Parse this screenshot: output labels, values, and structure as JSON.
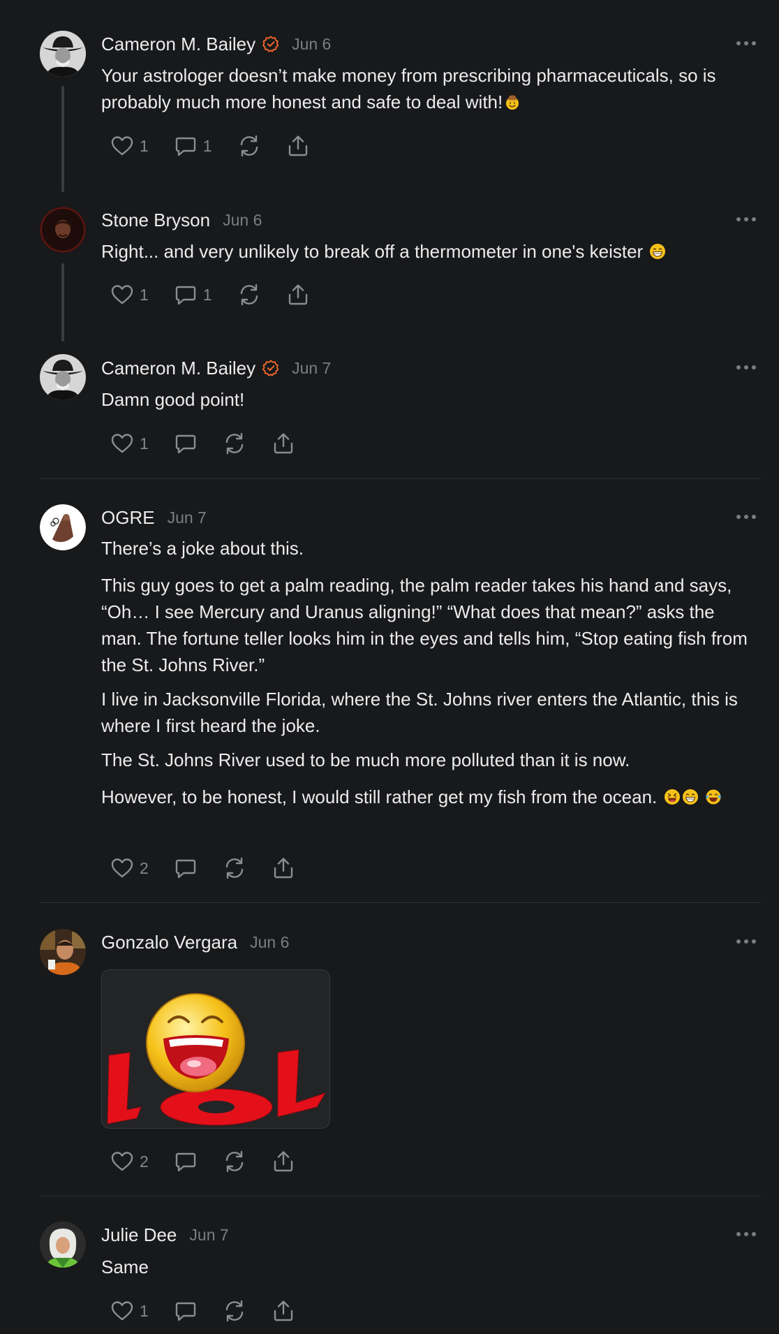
{
  "comments": [
    {
      "author": "Cameron M. Bailey",
      "verified": true,
      "date": "Jun 6",
      "paragraphs": [
        "Your astrologer doesn’t make money from prescribing pharmaceuticals, so is probably much more honest and safe to deal with!"
      ],
      "emoji": "cowboy-face",
      "likes": "1",
      "replies": "1"
    },
    {
      "author": "Stone Bryson",
      "verified": false,
      "date": "Jun 6",
      "paragraphs": [
        "Right... and very unlikely to break off a thermometer in one's keister"
      ],
      "emoji": "grinning-face",
      "likes": "1",
      "replies": "1"
    },
    {
      "author": "Cameron M. Bailey",
      "verified": true,
      "date": "Jun 7",
      "paragraphs": [
        "Damn good point!"
      ],
      "likes": "1",
      "replies": ""
    },
    {
      "author": "OGRE",
      "verified": false,
      "date": "Jun 7",
      "paragraphs": [
        "There’s a joke about this.",
        "This guy goes to get a palm reading, the palm reader takes his hand and says, “Oh… I see Mercury and Uranus aligning!” “What does that mean?” asks the man. The fortune teller looks him in the eyes and tells him, “Stop eating fish from the St. Johns River.”",
        "I live in Jacksonville Florida, where the St. Johns river enters the Atlantic, this is where I first heard the joke.",
        "The St. Johns River used to be much more polluted than it is now.",
        "However, to be honest, I would still rather get my fish from the ocean."
      ],
      "emoji_trailing": [
        "laughing-squint-face",
        "grinning-face",
        "tears-of-joy-face"
      ],
      "likes": "2",
      "replies": ""
    },
    {
      "author": "Gonzalo Vergara",
      "verified": false,
      "date": "Jun 6",
      "media": "lol-laughing-smiley-image",
      "likes": "2",
      "replies": ""
    },
    {
      "author": "Julie Dee",
      "verified": false,
      "date": "Jun 7",
      "paragraphs": [
        "Same"
      ],
      "likes": "1",
      "replies": ""
    }
  ],
  "icons": {
    "like": "heart-icon",
    "reply": "comment-bubble-icon",
    "restack": "repost-icon",
    "share": "share-icon",
    "more": "more-dots-icon",
    "verified": "verified-check-icon"
  },
  "colors": {
    "background": "#18191b",
    "text": "#ececed",
    "muted": "#7c7d82",
    "verified": "#f2682a",
    "lol_red": "#e3101a",
    "smiley_yellow": "#f6c21a"
  }
}
